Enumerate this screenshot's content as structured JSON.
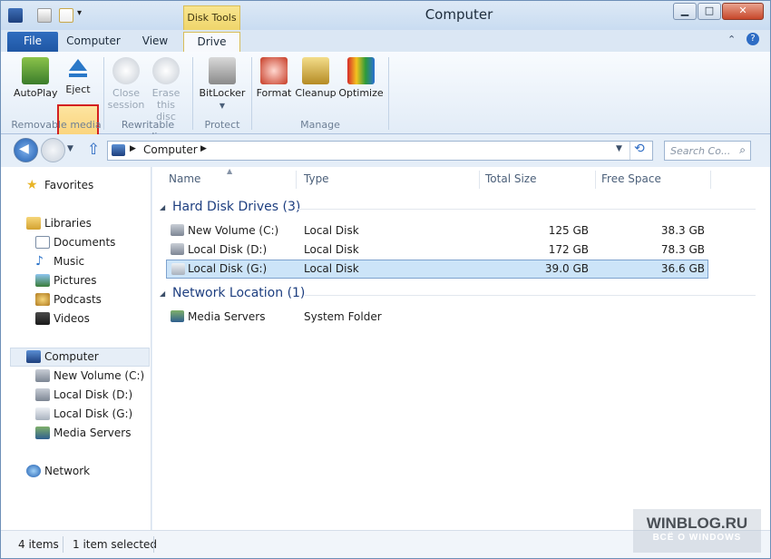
{
  "window": {
    "title": "Computer",
    "min_label": "▁",
    "max_label": "□",
    "close_label": "✕"
  },
  "quick_access": [
    "computer-icon",
    "properties-icon",
    "new-folder-icon",
    "customize-arrow"
  ],
  "context_header": "Disk Tools",
  "tabs": [
    {
      "label": "File"
    },
    {
      "label": "Computer"
    },
    {
      "label": "View"
    },
    {
      "label": "Drive"
    }
  ],
  "ribbon": {
    "groups": [
      {
        "name": "Removable media",
        "buttons": [
          {
            "label": "AutoPlay"
          },
          {
            "label": "Eject"
          }
        ]
      },
      {
        "name": "Rewritable media",
        "buttons": [
          {
            "label": "Close session"
          },
          {
            "label": "Erase this disc"
          }
        ]
      },
      {
        "name": "Protect",
        "buttons": [
          {
            "label": "BitLocker"
          }
        ]
      },
      {
        "name": "Manage",
        "buttons": [
          {
            "label": "Format"
          },
          {
            "label": "Cleanup"
          },
          {
            "label": "Optimize"
          }
        ]
      }
    ],
    "close_session_l1": "Close",
    "close_session_l2": "session",
    "erase_l1": "Erase",
    "erase_l2": "this disc"
  },
  "address": {
    "crumb": "Computer",
    "search_placeholder": "Search Co..."
  },
  "nav": {
    "favorites": "Favorites",
    "libraries": "Libraries",
    "library_items": [
      "Documents",
      "Music",
      "Pictures",
      "Podcasts",
      "Videos"
    ],
    "computer": "Computer",
    "computer_items": [
      "New Volume (C:)",
      "Local Disk (D:)",
      "Local Disk (G:)",
      "Media Servers"
    ],
    "network": "Network"
  },
  "columns": [
    "Name",
    "Type",
    "Total Size",
    "Free Space"
  ],
  "groups": [
    {
      "title": "Hard Disk Drives (3)",
      "rows": [
        {
          "name": "New Volume (C:)",
          "type": "Local Disk",
          "total": "125 GB",
          "free": "38.3 GB"
        },
        {
          "name": "Local Disk (D:)",
          "type": "Local Disk",
          "total": "172 GB",
          "free": "78.3 GB"
        },
        {
          "name": "Local Disk (G:)",
          "type": "Local Disk",
          "total": "39.0 GB",
          "free": "36.6 GB"
        }
      ]
    },
    {
      "title": "Network Location (1)",
      "rows": [
        {
          "name": "Media Servers",
          "type": "System Folder",
          "total": "",
          "free": ""
        }
      ]
    }
  ],
  "status": {
    "items": "4 items",
    "selected": "1 item selected"
  },
  "watermark": {
    "l1": "WINBLOG.RU",
    "l2": "ВСЁ О WINDOWS"
  },
  "colors": {
    "accent": "#1f57a4",
    "selection": "#cce4f8",
    "eject_highlight": "#d32020",
    "context_tab": "#efd56b"
  }
}
